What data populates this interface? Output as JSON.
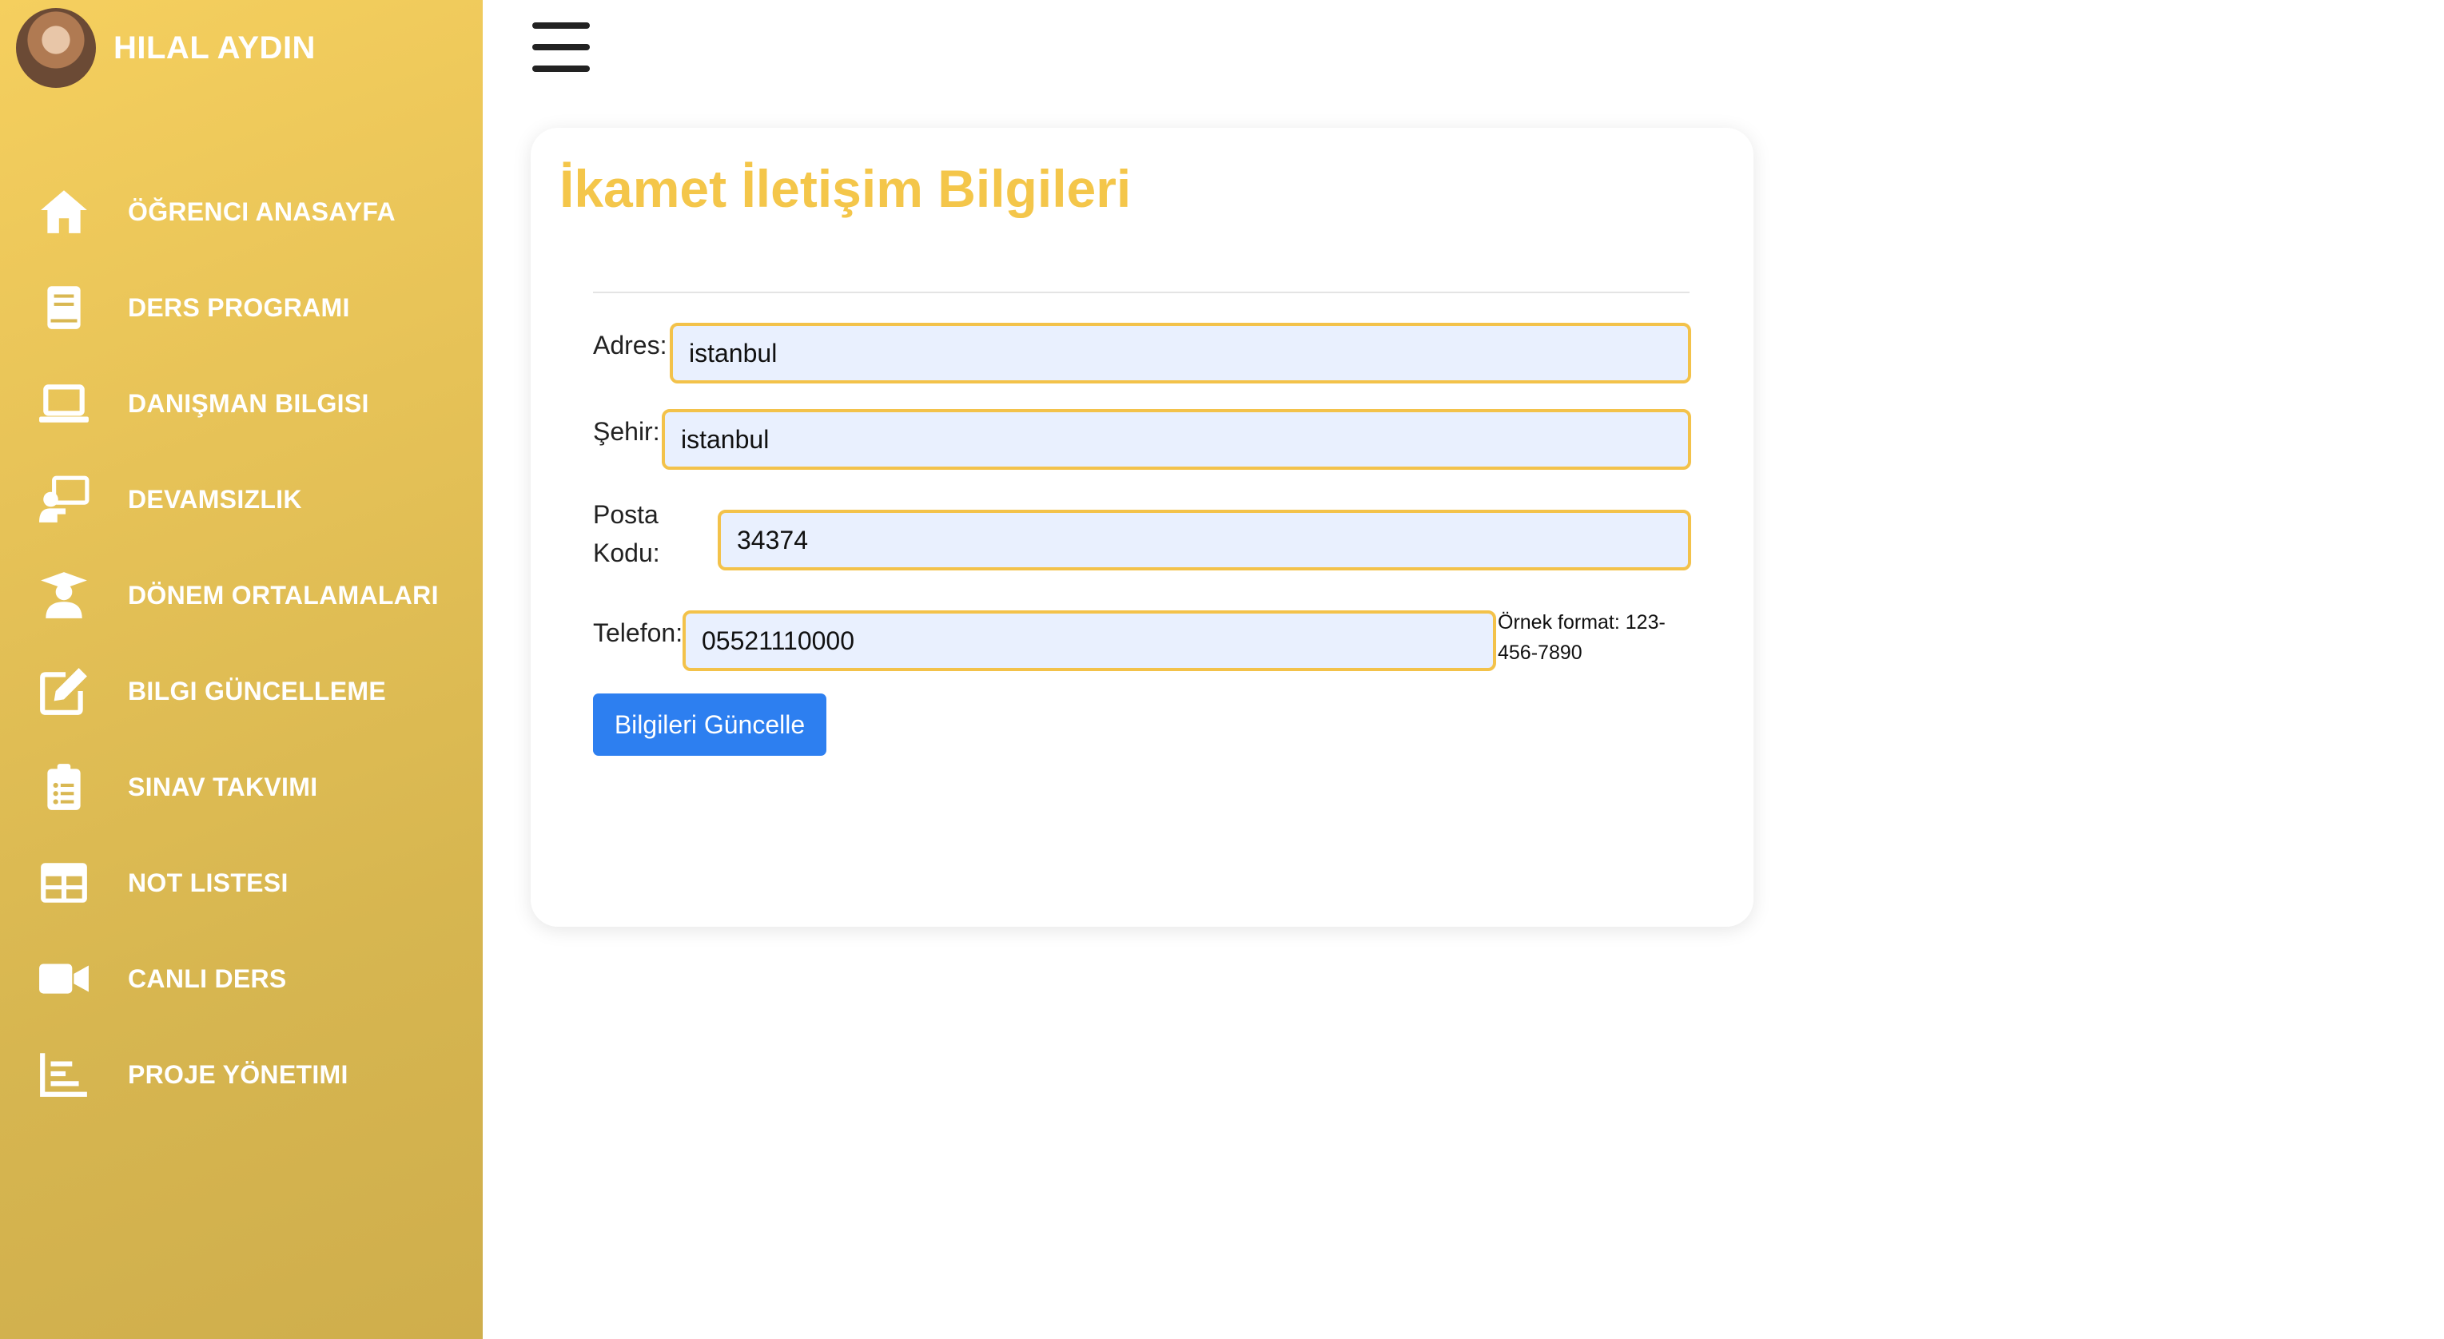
{
  "user": {
    "name": "HILAL AYDIN"
  },
  "sidebar": {
    "items": [
      {
        "label": "ÖĞRENCI ANASAYFA",
        "icon": "home-icon"
      },
      {
        "label": "DERS PROGRAMI",
        "icon": "book-icon"
      },
      {
        "label": "DANIŞMAN BILGISI",
        "icon": "laptop-icon"
      },
      {
        "label": "DEVAMSIZLIK",
        "icon": "teacher-board-icon"
      },
      {
        "label": "DÖNEM ORTALAMALARI",
        "icon": "graduate-icon"
      },
      {
        "label": "BILGI GÜNCELLEME",
        "icon": "edit-icon"
      },
      {
        "label": "SINAV TAKVIMI",
        "icon": "clipboard-list-icon"
      },
      {
        "label": "NOT LISTESI",
        "icon": "table-icon"
      },
      {
        "label": "CANLI DERS",
        "icon": "video-icon"
      },
      {
        "label": "PROJE YÖNETIMI",
        "icon": "chart-bars-icon"
      }
    ]
  },
  "form": {
    "title": "İkamet İletişim Bilgileri",
    "adres_label": "Adres:",
    "adres_value": "istanbul",
    "sehir_label": "Şehir:",
    "sehir_value": "istanbul",
    "posta_label_line1": "Posta",
    "posta_label_line2": "Kodu:",
    "posta_value": "34374",
    "telefon_label": "Telefon:",
    "telefon_value": "05521110000",
    "telefon_hint": "Örnek format: 123-456-7890",
    "submit_label": "Bilgileri Güncelle"
  },
  "colors": {
    "sidebar_gradient_start": "#f5cf5e",
    "sidebar_gradient_end": "#cfae4c",
    "title": "#f4c64a",
    "field_border": "#f3c24a",
    "field_bg": "#e9f0fe",
    "button": "#2d7ff0"
  }
}
